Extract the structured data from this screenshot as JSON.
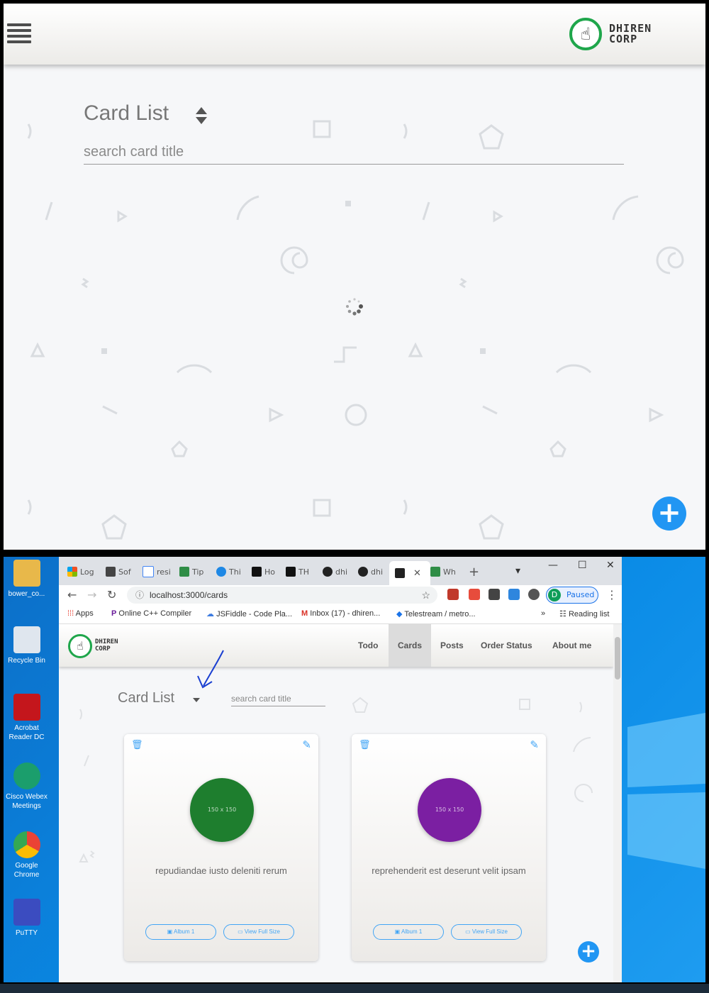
{
  "mobile": {
    "logo": {
      "line1": "DHIREN",
      "line2": "CORP"
    },
    "title": "Card List",
    "search_placeholder": "search card title"
  },
  "desktop_icons": [
    {
      "label": "bower_co...",
      "color": "#e8b84a"
    },
    {
      "label": "Recycle Bin",
      "color": "#dfe6ee"
    },
    {
      "label": "Acrobat Reader DC",
      "color": "#c4161c"
    },
    {
      "label": "Cisco Webex Meetings",
      "color": "#1b9e6c"
    },
    {
      "label": "Google Chrome",
      "color": "#4285f4"
    },
    {
      "label": "PuTTY",
      "color": "#3b4cc0"
    }
  ],
  "browser": {
    "tabs": [
      "Log",
      "Sof",
      "resi",
      "Tip",
      "Thi",
      "Ho",
      "TH",
      "dhi",
      "dhi",
      "",
      "Wh"
    ],
    "new_tab": "+",
    "url": "localhost:3000/cards",
    "profile_initial": "D",
    "profile_status": "Paused",
    "bookmarks": [
      "Apps",
      "Online C++ Compiler",
      "JSFiddle - Code Pla...",
      "Inbox (17) - dhiren...",
      "Telestream / metro...",
      "»",
      "Reading list"
    ]
  },
  "site": {
    "logo": {
      "line1": "DHIREN",
      "line2": "CORP"
    },
    "nav": [
      "Todo",
      "Cards",
      "Posts",
      "Order Status",
      "About me"
    ],
    "active_nav": "Cards",
    "title": "Card List",
    "search_placeholder": "search card title",
    "cards": [
      {
        "thumb_label": "150 x 150",
        "thumb_color": "#1e7e2e",
        "title": "repudiandae iusto deleniti rerum",
        "album_btn": "Album 1",
        "view_btn": "View Full Size"
      },
      {
        "thumb_label": "150 x 150",
        "thumb_color": "#7b1fa2",
        "title": "reprehenderit est deserunt velit ipsam",
        "album_btn": "Album 1",
        "view_btn": "View Full Size"
      }
    ]
  },
  "colors": {
    "accent": "#2196f3",
    "logo_green": "#1fa64b"
  }
}
